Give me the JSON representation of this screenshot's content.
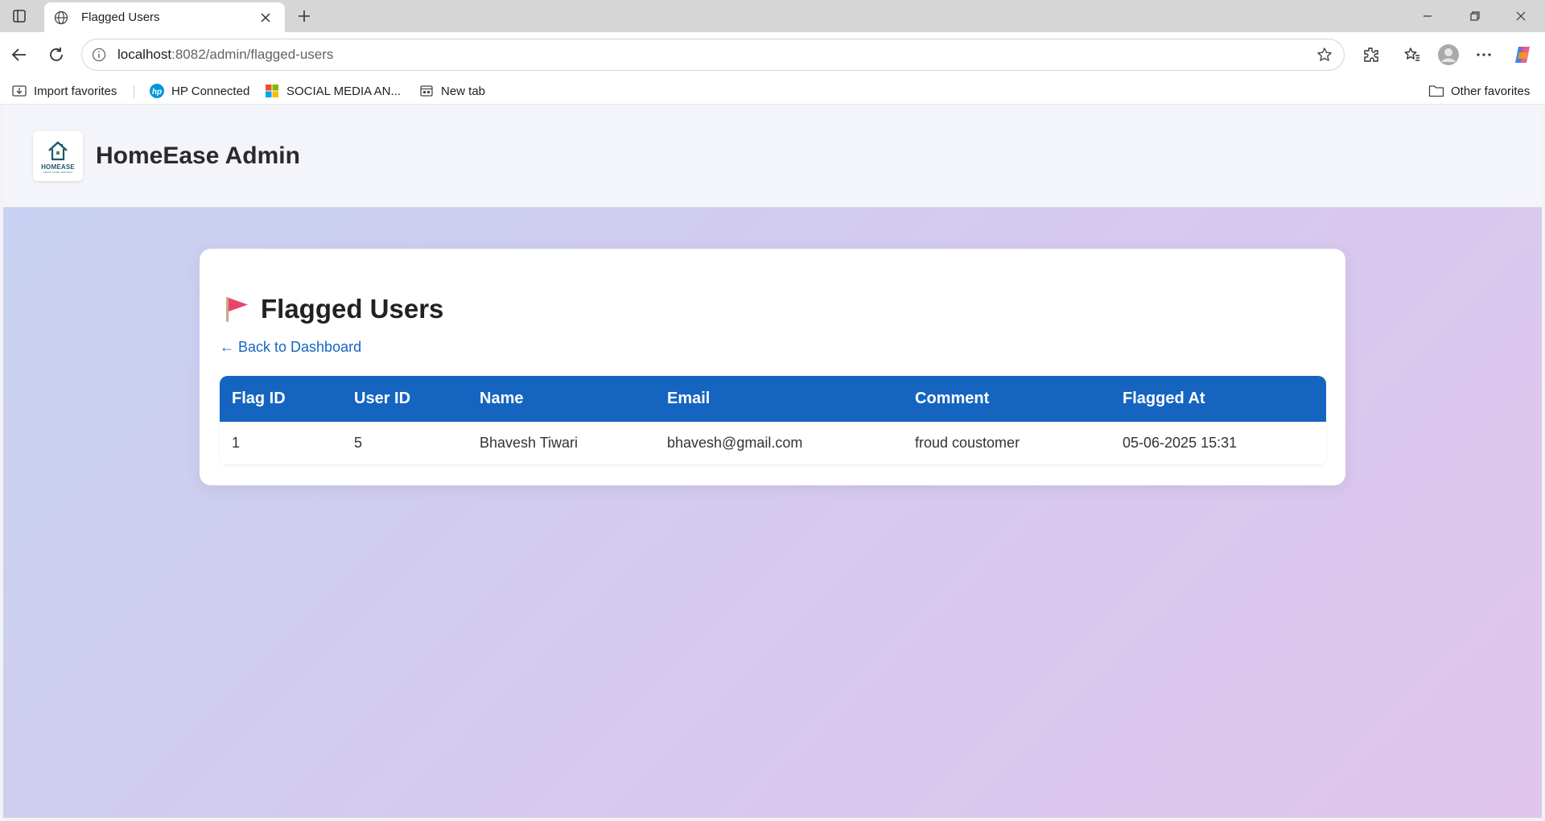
{
  "browser": {
    "tab_title": "Flagged Users",
    "url_host": "localhost",
    "url_rest": ":8082/admin/flagged-users",
    "bookmarks": [
      {
        "label": "Import favorites",
        "icon": "import-icon"
      },
      {
        "label": "HP Connected",
        "icon": "hp-icon"
      },
      {
        "label": "SOCIAL MEDIA AN...",
        "icon": "microsoft-icon"
      },
      {
        "label": "New tab",
        "icon": "newtab-icon"
      }
    ],
    "other_favorites": "Other favorites"
  },
  "header": {
    "logo_text": "HOMEASE",
    "logo_subtext": "SMART HOME SERVICES",
    "title": "HomeEase Admin"
  },
  "page": {
    "title": "Flagged Users",
    "back_link": "← Back to Dashboard"
  },
  "table": {
    "columns": [
      "Flag ID",
      "User ID",
      "Name",
      "Email",
      "Comment",
      "Flagged At"
    ],
    "rows": [
      [
        "1",
        "5",
        "Bhavesh Tiwari",
        "bhavesh@gmail.com",
        "froud coustomer",
        "05-06-2025 15:31"
      ]
    ]
  },
  "colors": {
    "accent": "#1565c0",
    "flag": "#e8456b"
  }
}
